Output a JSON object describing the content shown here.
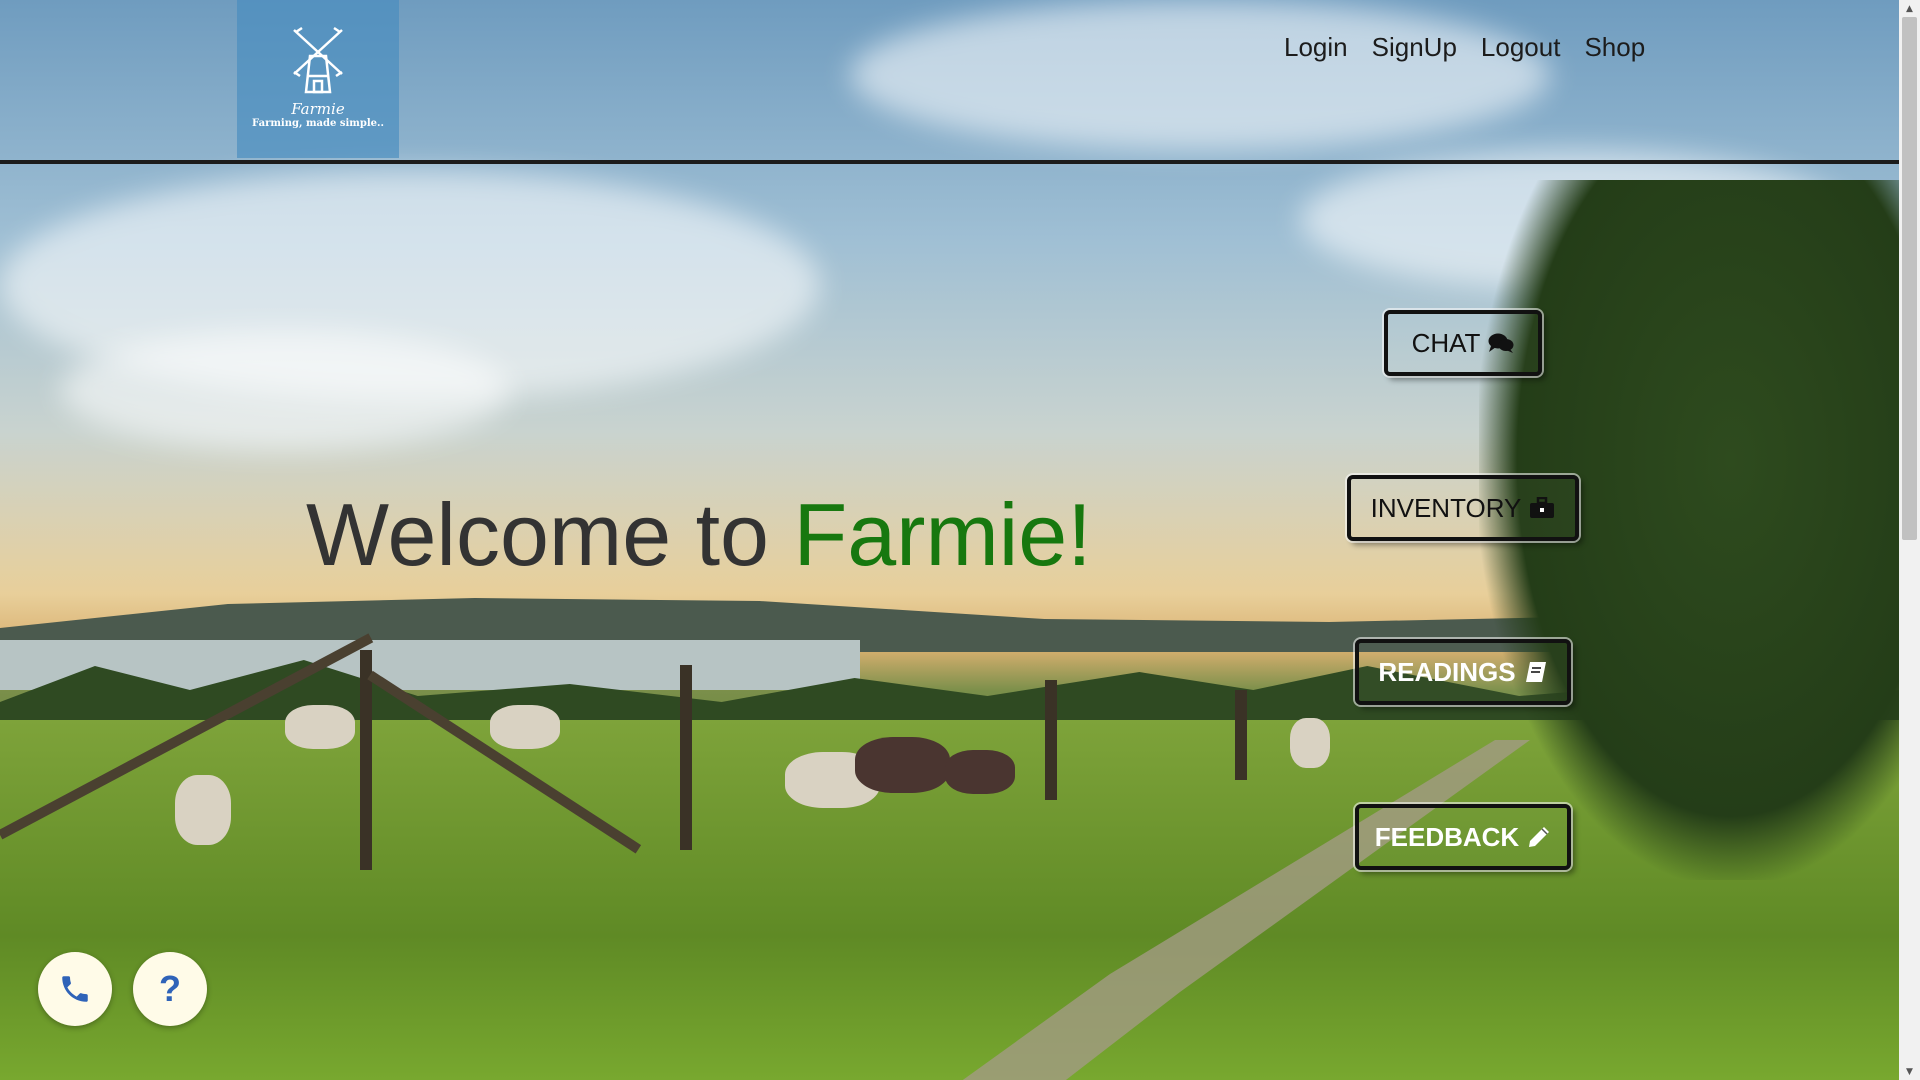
{
  "brand": {
    "name": "Farmie",
    "tagline": "Farming, made simple.."
  },
  "nav": {
    "login": "Login",
    "signup": "SignUp",
    "logout": "Logout",
    "shop": "Shop"
  },
  "hero": {
    "welcome_prefix": "Welcome to ",
    "welcome_accent": "Farmie!"
  },
  "actions": {
    "chat": {
      "label": "CHAT",
      "icon": "comments-icon"
    },
    "inventory": {
      "label": "INVENTORY",
      "icon": "briefcase-icon"
    },
    "readings": {
      "label": "READINGS",
      "icon": "book-icon"
    },
    "feedback": {
      "label": "FEEDBACK",
      "icon": "pencil-icon"
    }
  },
  "floating": {
    "phone_icon": "phone-icon",
    "help_symbol": "?"
  },
  "colors": {
    "accent": "#17780f",
    "help": "#2f63b8",
    "phone": "#2f63b8",
    "logo_bg": "#468cbe"
  }
}
